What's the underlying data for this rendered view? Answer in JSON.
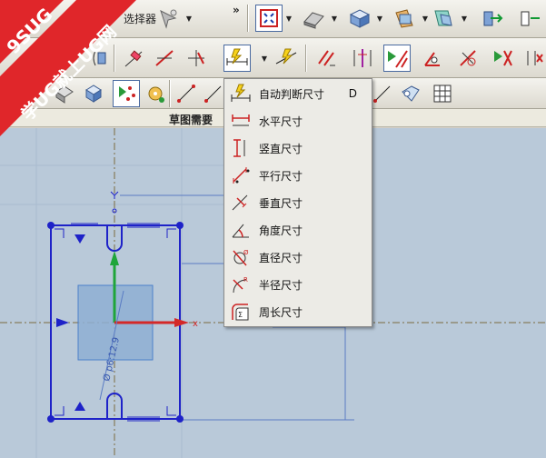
{
  "toolbar_top": {
    "partial_label": "选择器",
    "overflow": "»"
  },
  "section": {
    "label": "草图需要"
  },
  "dimension_menu": {
    "items": [
      {
        "label": "自动判断尺寸",
        "shortcut": "D",
        "icon": "inferred-dimension-icon"
      },
      {
        "label": "水平尺寸",
        "icon": "horizontal-dimension-icon"
      },
      {
        "label": "竖直尺寸",
        "icon": "vertical-dimension-icon"
      },
      {
        "label": "平行尺寸",
        "icon": "parallel-dimension-icon"
      },
      {
        "label": "垂直尺寸",
        "icon": "perpendicular-dimension-icon"
      },
      {
        "label": "角度尺寸",
        "icon": "angular-dimension-icon"
      },
      {
        "label": "直径尺寸",
        "icon": "diameter-dimension-icon"
      },
      {
        "label": "半径尺寸",
        "icon": "radius-dimension-icon"
      },
      {
        "label": "周长尺寸",
        "icon": "perimeter-dimension-icon"
      }
    ]
  },
  "watermark": {
    "line1": "9SUG",
    "line2": "学UG就上UG网"
  },
  "sketch": {
    "dimension_text": "Ø p6:12.9"
  },
  "colors": {
    "canvas": "#b9c9d9",
    "sketch_line": "#1e22c8",
    "watermark_red": "#e0262a"
  }
}
